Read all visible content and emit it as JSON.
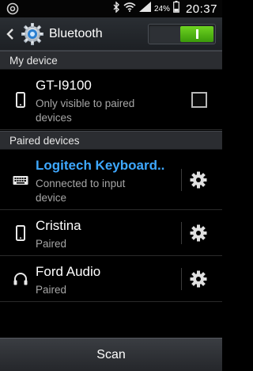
{
  "status_bar": {
    "battery_percent": "24%",
    "time": "20:37",
    "icons": [
      "notification-icon",
      "bluetooth-icon",
      "wifi-icon",
      "signal-icon",
      "battery-icon"
    ]
  },
  "action_bar": {
    "title": "Bluetooth",
    "toggle_state": "on",
    "accent_color": "#3ea8ff",
    "toggle_color": "#5cc21a"
  },
  "my_device": {
    "header": "My device",
    "name": "GT-I9100",
    "subtitle_line1": "Only visible to paired",
    "subtitle_line2": "devices",
    "visible_checked": false
  },
  "paired_devices": {
    "header": "Paired devices",
    "items": [
      {
        "name": "Logitech Keyboard..",
        "status_line1": "Connected to input",
        "status_line2": "device",
        "icon": "keyboard-icon",
        "connected": true
      },
      {
        "name": "Cristina",
        "status_line1": "Paired",
        "icon": "phone-icon",
        "connected": false
      },
      {
        "name": "Ford Audio",
        "status_line1": "Paired",
        "icon": "headphones-icon",
        "connected": false
      }
    ]
  },
  "bottom_bar": {
    "scan_label": "Scan"
  }
}
